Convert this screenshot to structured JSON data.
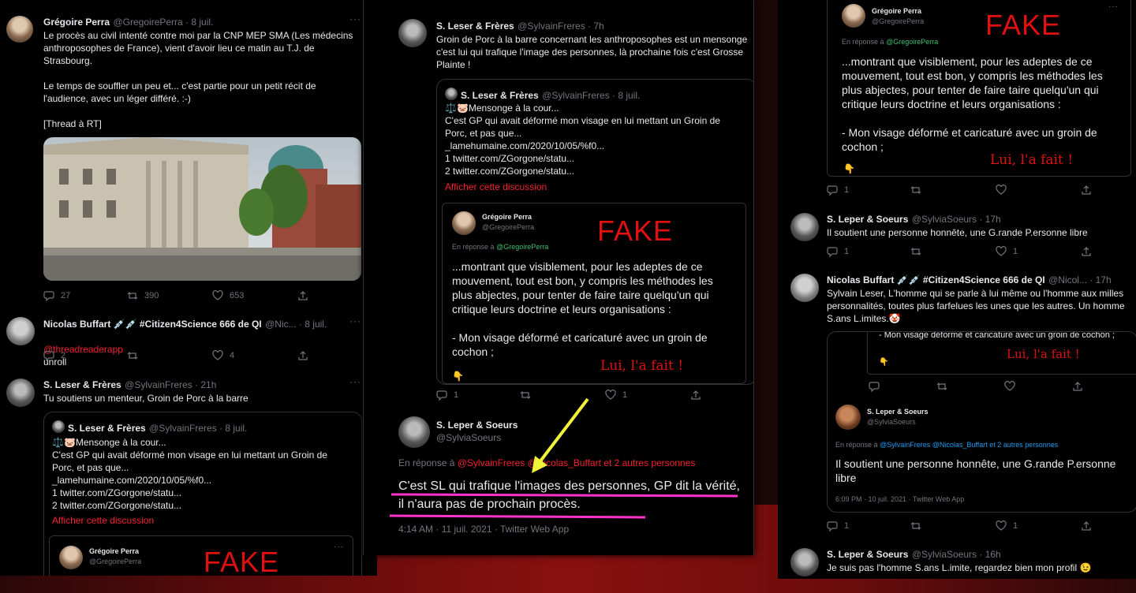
{
  "p1": {
    "t1": {
      "name": "Grégoire Perra",
      "handle": "@GregoirePerra · 8 juil.",
      "text": "Le procès au civil intenté contre moi par la CNP MEP SMA (Les médecins anthroposophes de France), vient d'avoir lieu ce matin au T.J. de Strasbourg.\n\nLe temps de souffler un peu et... c'est partie pour un petit récit de l'audience, avec un léger différé. :-)\n\n[Thread à RT]",
      "replies": "27",
      "retweets": "390",
      "likes": "653"
    },
    "t2": {
      "name": "Nicolas Buffart 💉💉 #Citizen4Science 666 de QI",
      "handle": "@Nic... · 8 juil.",
      "mention": "@threadreaderapp",
      "text": "unroll",
      "replies": "2",
      "likes": "4"
    },
    "t3": {
      "name": "S. Leser & Frères",
      "handle": "@SylvainFreres · 21h",
      "text": "Tu soutiens un menteur, Groin de Porc à la barre",
      "quote": {
        "name": "S. Leser & Frères",
        "handle": "@SylvainFreres · 8 juil.",
        "text": "⚖️🐷Mensonge à la cour...\nC'est GP qui avait déformé mon visage en lui mettant un Groin de Porc, et pas que...\n_lamehumaine.com/2020/10/05/%f0...\n1 twitter.com/ZGorgone/statu...\n2 twitter.com/ZGorgone/statu...",
        "show": "Afficher cette discussion",
        "inner": {
          "name": "Grégoire Perra",
          "handle": "@GregoirePerra",
          "fake": "FAKE"
        }
      }
    }
  },
  "p2": {
    "t1": {
      "name": "S. Leser & Frères",
      "handle": "@SylvainFreres · 7h",
      "text": "Groin de Porc à la barre concernant les anthroposophes est un mensonge c'est lui qui trafique l'image des personnes, là prochaine fois c'est Grosse Plainte !",
      "quote": {
        "name": "S. Leser & Frères",
        "handle": "@SylvainFreres · 8 juil.",
        "text": "⚖️🐷Mensonge à la cour...\nC'est GP qui avait déformé mon visage en lui mettant un Groin de Porc, et pas que...\n_lamehumaine.com/2020/10/05/%f0...\n1 twitter.com/ZGorgone/statu...\n2 twitter.com/ZGorgone/statu...",
        "show": "Afficher cette discussion",
        "shot": {
          "name": "Grégoire Perra",
          "handle": "@GregoirePerra",
          "reply_prefix": "En réponse à",
          "reply_to": "@GregoirePerra",
          "text": "...montrant que visiblement, pour les adeptes de ce mouvement, tout est bon, y compris les méthodes les plus abjectes, pour tenter de faire taire quelqu'un qui critique leurs doctrine et leurs organisations :\n\n- Mon visage déformé et caricaturé avec un groin de cochon ;",
          "fake": "FAKE",
          "lui": "Lui, l'a fait !"
        }
      },
      "replies": "1",
      "likes": "1"
    },
    "main": {
      "name": "S. Leper & Soeurs",
      "handle": "@SylviaSoeurs",
      "reply_prefix": "En réponse à",
      "reply_to": "@SylvainFreres @Nicolas_Buffart",
      "reply_rest": "et 2 autres personnes",
      "text": "C'est SL qui trafique l'images des personnes, GP dit la vérité, il n'aura pas de prochain procès.",
      "time": "4:14 AM · 11 juil. 2021 · Twitter Web App"
    }
  },
  "p3": {
    "shot": {
      "name": "Grégoire Perra",
      "handle": "@GregoirePerra",
      "reply_prefix": "En réponse à",
      "reply_to": "@GregoirePerra",
      "text": "...montrant que visiblement, pour les adeptes de ce mouvement, tout est bon, y compris les méthodes les plus abjectes, pour tenter de faire taire quelqu'un qui critique leurs doctrine et leurs organisations :\n\n- Mon visage déformé et caricaturé avec un groin de cochon ;",
      "fake": "FAKE",
      "lui": "Lui, l'a fait !"
    },
    "r0": {
      "replies": "1"
    },
    "t1": {
      "name": "S. Leper & Soeurs",
      "handle": "@SylviaSoeurs · 17h",
      "text": "Il soutient une personne honnête, une G.rande P.ersonne libre",
      "replies": "1",
      "likes": "1"
    },
    "t2": {
      "name": "Nicolas Buffart 💉💉 #Citizen4Science 666 de QI",
      "handle": "@Nicol... · 17h",
      "text": "Sylvain Leser, L'homme qui se parle à lui même ou l'homme aux milles personnalités, toutes plus farfelues les unes que les autres. Un homme S.ans L.imites.🤡",
      "shot": {
        "text": "- Mon visage déformé et caricaturé avec un groin de cochon ;",
        "lui": "Lui, l'a fait !",
        "name": "S. Leper & Soeurs",
        "handle": "@SylviaSoeurs",
        "reply_prefix": "En réponse à",
        "reply_to": "@SylvainFreres @Nicolas_Buffart et 2 autres personnes",
        "body": "Il soutient une personne honnête, une G.rande P.ersonne libre",
        "time": "6:09 PM · 10 juil. 2021 · Twitter Web App"
      },
      "replies": "1",
      "likes": "1"
    },
    "t3": {
      "name": "S. Leper & Soeurs",
      "handle": "@SylviaSoeurs · 16h",
      "text": "Je suis pas l'homme S.ans L.imite, regardez bien mon profil 😉"
    }
  },
  "colors": {
    "accent_red": "#e01010",
    "link_red": "#f4212e",
    "highlight": "#ff33cc",
    "arrow": "#f2f23a"
  }
}
